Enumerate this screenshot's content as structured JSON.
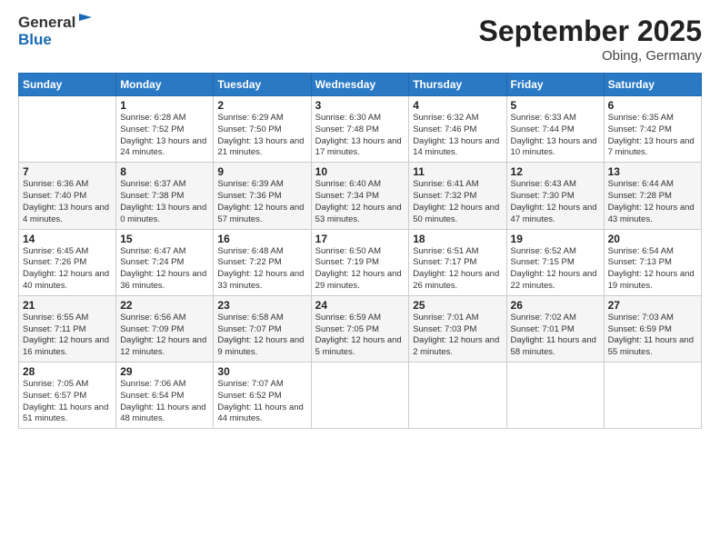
{
  "header": {
    "logo_line1": "General",
    "logo_line2": "Blue",
    "title": "September 2025",
    "location": "Obing, Germany"
  },
  "days_of_week": [
    "Sunday",
    "Monday",
    "Tuesday",
    "Wednesday",
    "Thursday",
    "Friday",
    "Saturday"
  ],
  "weeks": [
    [
      {
        "num": "",
        "info": ""
      },
      {
        "num": "1",
        "info": "Sunrise: 6:28 AM\nSunset: 7:52 PM\nDaylight: 13 hours\nand 24 minutes."
      },
      {
        "num": "2",
        "info": "Sunrise: 6:29 AM\nSunset: 7:50 PM\nDaylight: 13 hours\nand 21 minutes."
      },
      {
        "num": "3",
        "info": "Sunrise: 6:30 AM\nSunset: 7:48 PM\nDaylight: 13 hours\nand 17 minutes."
      },
      {
        "num": "4",
        "info": "Sunrise: 6:32 AM\nSunset: 7:46 PM\nDaylight: 13 hours\nand 14 minutes."
      },
      {
        "num": "5",
        "info": "Sunrise: 6:33 AM\nSunset: 7:44 PM\nDaylight: 13 hours\nand 10 minutes."
      },
      {
        "num": "6",
        "info": "Sunrise: 6:35 AM\nSunset: 7:42 PM\nDaylight: 13 hours\nand 7 minutes."
      }
    ],
    [
      {
        "num": "7",
        "info": "Sunrise: 6:36 AM\nSunset: 7:40 PM\nDaylight: 13 hours\nand 4 minutes."
      },
      {
        "num": "8",
        "info": "Sunrise: 6:37 AM\nSunset: 7:38 PM\nDaylight: 13 hours\nand 0 minutes."
      },
      {
        "num": "9",
        "info": "Sunrise: 6:39 AM\nSunset: 7:36 PM\nDaylight: 12 hours\nand 57 minutes."
      },
      {
        "num": "10",
        "info": "Sunrise: 6:40 AM\nSunset: 7:34 PM\nDaylight: 12 hours\nand 53 minutes."
      },
      {
        "num": "11",
        "info": "Sunrise: 6:41 AM\nSunset: 7:32 PM\nDaylight: 12 hours\nand 50 minutes."
      },
      {
        "num": "12",
        "info": "Sunrise: 6:43 AM\nSunset: 7:30 PM\nDaylight: 12 hours\nand 47 minutes."
      },
      {
        "num": "13",
        "info": "Sunrise: 6:44 AM\nSunset: 7:28 PM\nDaylight: 12 hours\nand 43 minutes."
      }
    ],
    [
      {
        "num": "14",
        "info": "Sunrise: 6:45 AM\nSunset: 7:26 PM\nDaylight: 12 hours\nand 40 minutes."
      },
      {
        "num": "15",
        "info": "Sunrise: 6:47 AM\nSunset: 7:24 PM\nDaylight: 12 hours\nand 36 minutes."
      },
      {
        "num": "16",
        "info": "Sunrise: 6:48 AM\nSunset: 7:22 PM\nDaylight: 12 hours\nand 33 minutes."
      },
      {
        "num": "17",
        "info": "Sunrise: 6:50 AM\nSunset: 7:19 PM\nDaylight: 12 hours\nand 29 minutes."
      },
      {
        "num": "18",
        "info": "Sunrise: 6:51 AM\nSunset: 7:17 PM\nDaylight: 12 hours\nand 26 minutes."
      },
      {
        "num": "19",
        "info": "Sunrise: 6:52 AM\nSunset: 7:15 PM\nDaylight: 12 hours\nand 22 minutes."
      },
      {
        "num": "20",
        "info": "Sunrise: 6:54 AM\nSunset: 7:13 PM\nDaylight: 12 hours\nand 19 minutes."
      }
    ],
    [
      {
        "num": "21",
        "info": "Sunrise: 6:55 AM\nSunset: 7:11 PM\nDaylight: 12 hours\nand 16 minutes."
      },
      {
        "num": "22",
        "info": "Sunrise: 6:56 AM\nSunset: 7:09 PM\nDaylight: 12 hours\nand 12 minutes."
      },
      {
        "num": "23",
        "info": "Sunrise: 6:58 AM\nSunset: 7:07 PM\nDaylight: 12 hours\nand 9 minutes."
      },
      {
        "num": "24",
        "info": "Sunrise: 6:59 AM\nSunset: 7:05 PM\nDaylight: 12 hours\nand 5 minutes."
      },
      {
        "num": "25",
        "info": "Sunrise: 7:01 AM\nSunset: 7:03 PM\nDaylight: 12 hours\nand 2 minutes."
      },
      {
        "num": "26",
        "info": "Sunrise: 7:02 AM\nSunset: 7:01 PM\nDaylight: 11 hours\nand 58 minutes."
      },
      {
        "num": "27",
        "info": "Sunrise: 7:03 AM\nSunset: 6:59 PM\nDaylight: 11 hours\nand 55 minutes."
      }
    ],
    [
      {
        "num": "28",
        "info": "Sunrise: 7:05 AM\nSunset: 6:57 PM\nDaylight: 11 hours\nand 51 minutes."
      },
      {
        "num": "29",
        "info": "Sunrise: 7:06 AM\nSunset: 6:54 PM\nDaylight: 11 hours\nand 48 minutes."
      },
      {
        "num": "30",
        "info": "Sunrise: 7:07 AM\nSunset: 6:52 PM\nDaylight: 11 hours\nand 44 minutes."
      },
      {
        "num": "",
        "info": ""
      },
      {
        "num": "",
        "info": ""
      },
      {
        "num": "",
        "info": ""
      },
      {
        "num": "",
        "info": ""
      }
    ]
  ]
}
